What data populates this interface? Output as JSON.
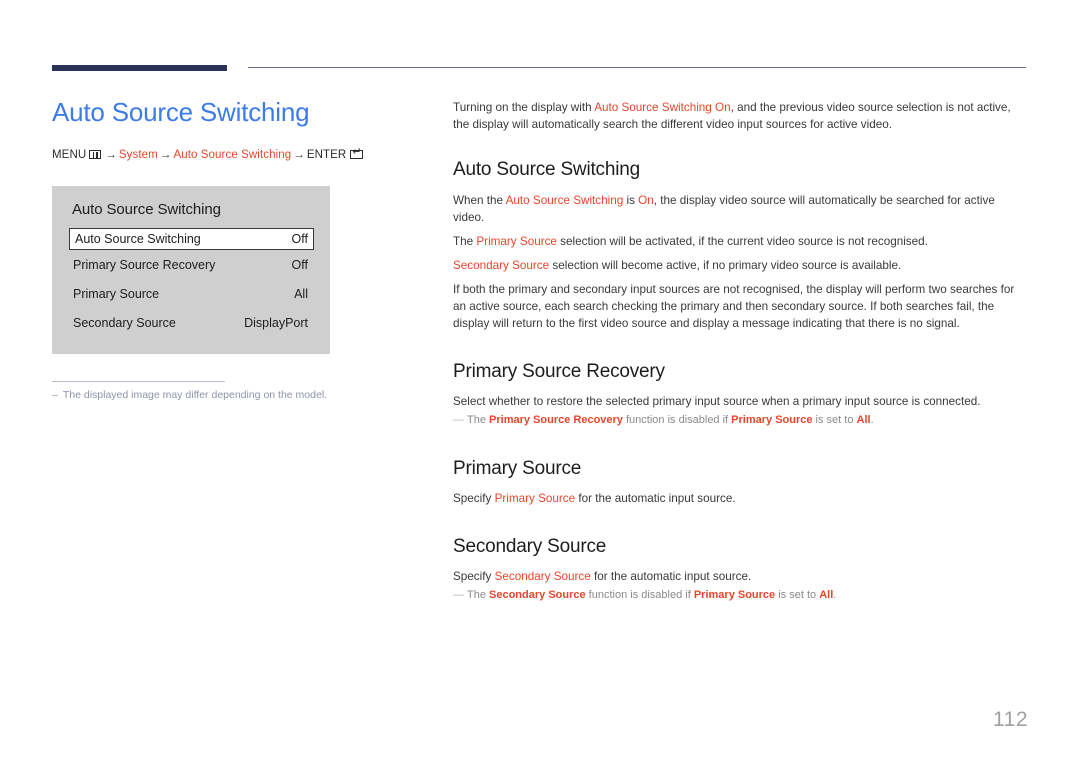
{
  "header": {
    "rule_color": "#2b3257"
  },
  "left": {
    "page_title": "Auto Source Switching",
    "breadcrumb": {
      "menu_label": "MENU",
      "menu_icon": "menu-grid-icon",
      "arrow": "→",
      "item1": "System",
      "item2": "Auto Source Switching",
      "enter_label": "ENTER",
      "enter_icon": "enter-key-icon"
    },
    "osd": {
      "title": "Auto Source Switching",
      "rows": [
        {
          "label": "Auto Source Switching",
          "value": "Off",
          "selected": true
        },
        {
          "label": "Primary Source Recovery",
          "value": "Off",
          "selected": false
        },
        {
          "label": "Primary Source",
          "value": "All",
          "selected": false
        },
        {
          "label": "Secondary Source",
          "value": "DisplayPort",
          "selected": false
        }
      ]
    },
    "note": {
      "dash": "–",
      "text": "The displayed image may differ depending on the model."
    }
  },
  "right": {
    "intro": {
      "part1": "Turning on the display with ",
      "accent1": "Auto Source Switching On",
      "part2": ", and the previous video source selection is not active, the display will automatically search the different video input sources for active video."
    },
    "sections": [
      {
        "heading": "Auto Source Switching",
        "paragraphs": [
          {
            "part1": "When the ",
            "accent1": "Auto Source Switching",
            "part2": " is ",
            "accent2": "On",
            "part3": ", the display video source will automatically be searched for active video."
          },
          {
            "part1": "The ",
            "accent1": "Primary Source",
            "part2": " selection will be activated, if the current video source is not recognised."
          },
          {
            "part1": "",
            "accent1": "Secondary Source",
            "part2": " selection will become active, if no primary video source is available."
          },
          {
            "part1": "If both the primary and secondary input sources are not recognised, the display will perform two searches for an active source, each search checking the primary and then secondary source. If both searches fail, the display will return to the first video source and display a message indicating that there is no signal."
          }
        ]
      },
      {
        "heading": "Primary Source Recovery",
        "body": "Select whether to restore the selected primary input source when a primary input source is connected.",
        "note": {
          "dash": "—",
          "part1": "The ",
          "accent1": "Primary Source Recovery",
          "part2": " function is disabled if ",
          "accent2": "Primary Source",
          "part3": " is set to ",
          "accent3": "All",
          "part4": "."
        }
      },
      {
        "heading": "Primary Source",
        "body_part1": "Specify ",
        "body_accent1": "Primary Source",
        "body_part2": " for the automatic input source."
      },
      {
        "heading": "Secondary Source",
        "body_part1": "Specify ",
        "body_accent1": "Secondary Source",
        "body_part2": " for the automatic input source.",
        "note": {
          "dash": "—",
          "part1": "The ",
          "accent1": "Secondary Source",
          "part2": " function is disabled if ",
          "accent2": "Primary Source",
          "part3": " is set to ",
          "accent3": "All",
          "part4": "."
        }
      }
    ]
  },
  "footer": {
    "page_number": "112"
  },
  "colors": {
    "accent": "#e8452c",
    "title_blue": "#3d7be8",
    "rule_navy": "#2b3257",
    "page_number": "#a0a0a0"
  }
}
